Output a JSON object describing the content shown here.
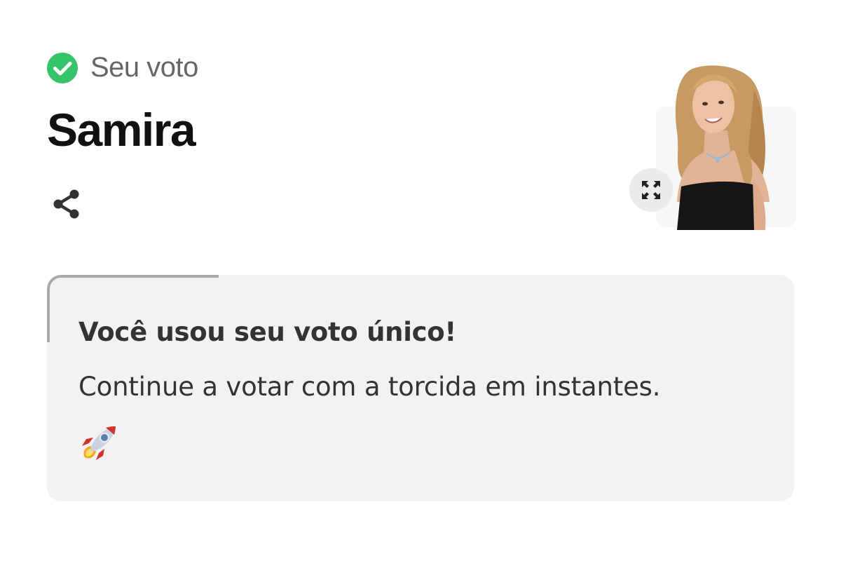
{
  "vote": {
    "status_label": "Seu voto",
    "status_icon": "check-circle-icon",
    "candidate_name": "Samira",
    "share_icon": "share-icon",
    "expand_icon": "expand-icon",
    "accent_color": "#35c46a"
  },
  "notice": {
    "title": "Você usou seu voto único!",
    "body": "Continue a votar com a torcida em instantes.",
    "emoji_icon": "rocket-icon"
  }
}
